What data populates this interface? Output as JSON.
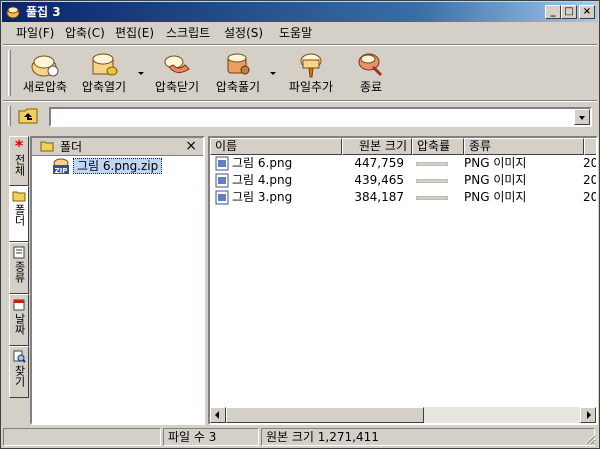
{
  "window": {
    "title": "풀집 3",
    "controls": {
      "minimize": "_",
      "maximize": "□",
      "close": "×"
    }
  },
  "menu": [
    {
      "label": "파일(F)"
    },
    {
      "label": "압축(C)"
    },
    {
      "label": "편집(E)"
    },
    {
      "label": "스크립트"
    },
    {
      "label": "설정(S)"
    },
    {
      "label": "도움말"
    }
  ],
  "toolbar": {
    "items": [
      {
        "label": "새로압축",
        "icon": "new-archive-icon"
      },
      {
        "label": "압축열기",
        "icon": "open-archive-icon"
      },
      {
        "label": "압축닫기",
        "icon": "close-archive-icon"
      },
      {
        "label": "압축풀기",
        "icon": "extract-icon"
      },
      {
        "label": "파일추가",
        "icon": "add-file-icon"
      },
      {
        "label": "종료",
        "icon": "exit-icon"
      }
    ]
  },
  "address": {
    "value": ""
  },
  "side_tabs": [
    {
      "label": "전체",
      "icon": "asterisk-icon"
    },
    {
      "label": "폴더",
      "icon": "folder-icon"
    },
    {
      "label": "종류",
      "icon": "type-icon"
    },
    {
      "label": "날짜",
      "icon": "calendar-icon"
    },
    {
      "label": "찾기",
      "icon": "find-icon"
    }
  ],
  "folder_pane": {
    "title": "폴더",
    "close": "×",
    "tree": [
      {
        "label": "그림 6.png.zip",
        "icon": "zip-icon"
      }
    ]
  },
  "file_list": {
    "columns": [
      "이름",
      "원본 크기",
      "압축률",
      "종류",
      ""
    ],
    "rows": [
      {
        "name": "그림 6.png",
        "size": "447,759",
        "ratio": "",
        "type": "PNG 이미지",
        "date": "20"
      },
      {
        "name": "그림 4.png",
        "size": "439,465",
        "ratio": "",
        "type": "PNG 이미지",
        "date": "20"
      },
      {
        "name": "그림 3.png",
        "size": "384,187",
        "ratio": "",
        "type": "PNG 이미지",
        "date": "20"
      }
    ]
  },
  "status": {
    "file_count": "파일 수 3",
    "original_size": "원본 크기  1,271,411"
  },
  "colors": {
    "titlebar_start": "#0a246a",
    "titlebar_end": "#a6caf0",
    "face": "#d4d0c8",
    "asterisk": "#e00000"
  }
}
